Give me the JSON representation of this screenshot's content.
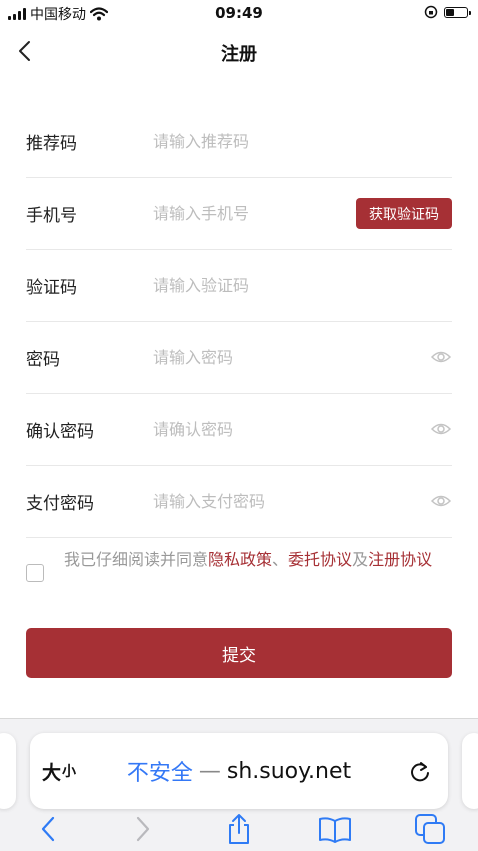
{
  "status_bar": {
    "carrier": "中国移动",
    "time": "09:49"
  },
  "nav": {
    "title": "注册"
  },
  "form": {
    "referral": {
      "label": "推荐码",
      "placeholder": "请输入推荐码"
    },
    "phone": {
      "label": "手机号",
      "placeholder": "请输入手机号",
      "code_button": "获取验证码"
    },
    "verify_code": {
      "label": "验证码",
      "placeholder": "请输入验证码"
    },
    "password": {
      "label": "密码",
      "placeholder": "请输入密码"
    },
    "confirm_password": {
      "label": "确认密码",
      "placeholder": "请确认密码"
    },
    "pay_password": {
      "label": "支付密码",
      "placeholder": "请输入支付密码"
    }
  },
  "agreement": {
    "prefix": "我已仔细阅读并同意",
    "privacy": "隐私政策",
    "sep1": "、",
    "entrust": "委托协议",
    "sep2": "及",
    "register": "注册协议"
  },
  "submit_label": "提交",
  "browser": {
    "size_label_big": "大",
    "size_label_small": "小",
    "insecure": "不安全",
    "separator": "—",
    "host": "sh.suoy.net"
  },
  "colors": {
    "accent": "#a63035",
    "link": "#3478f6"
  },
  "icons": [
    "back-chevron-icon",
    "eye-icon",
    "reload-icon",
    "share-icon",
    "bookmarks-icon",
    "tabs-icon"
  ]
}
